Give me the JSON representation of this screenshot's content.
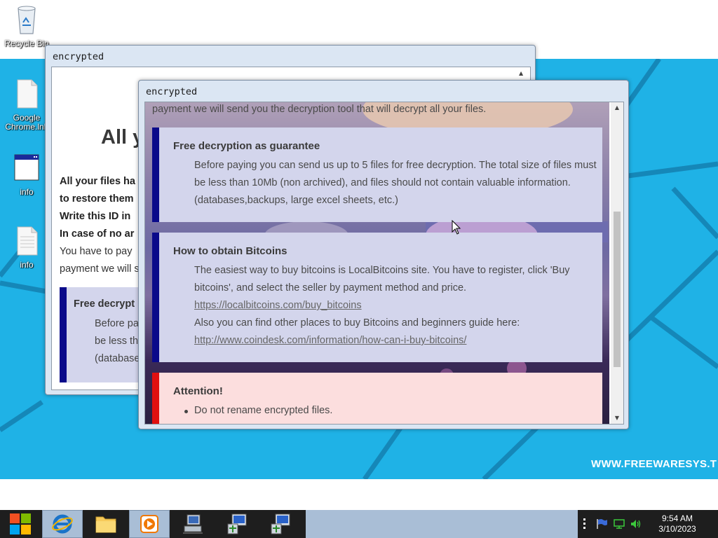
{
  "desktop": {
    "icons": [
      {
        "label": "Recycle Bin",
        "icon": "recycle-bin-icon"
      },
      {
        "label": "Google Chrome.lnk",
        "icon": "document-icon"
      },
      {
        "label": "info",
        "icon": "window-icon"
      },
      {
        "label": "info",
        "icon": "document-icon"
      }
    ],
    "watermark": "WWW.FREEWARESYS.T",
    "background_color": "#1fb2e6"
  },
  "back_window": {
    "title": "encrypted",
    "heading": "All y",
    "lines": [
      {
        "text": "All your files ha",
        "bold": true
      },
      {
        "text": "to restore them",
        "bold": true
      },
      {
        "text": "Write this ID in",
        "bold": true
      },
      {
        "text": "In case of no ar",
        "bold": true
      },
      {
        "text": "You have to pay",
        "bold": false
      },
      {
        "text": "payment we will s",
        "bold": false
      }
    ],
    "box": {
      "heading": "Free decrypt",
      "lines": [
        "Before pa",
        "be less th",
        "(database"
      ]
    }
  },
  "front_window": {
    "title": "encrypted",
    "top_line": "payment we will send you the decryption tool that will decrypt all your files.",
    "sections": [
      {
        "heading": "Free decryption as guarantee",
        "lines": [
          "Before paying you can send us up to 5 files for free decryption. The total size of files must",
          "be less than 10Mb (non archived), and files should not contain valuable information.",
          "(databases,backups, large excel sheets, etc.)"
        ]
      },
      {
        "heading": "How to obtain Bitcoins",
        "line1": "The easiest way to buy bitcoins is LocalBitcoins site. You have to register, click 'Buy",
        "line2": "bitcoins', and select the seller by payment method and price.",
        "link1": "https://localbitcoins.com/buy_bitcoins",
        "line3": "Also you can find other places to buy Bitcoins and beginners guide here:",
        "link2": "http://www.coindesk.com/information/how-can-i-buy-bitcoins/"
      },
      {
        "heading": "Attention!",
        "bullets": [
          "Do not rename encrypted files."
        ]
      }
    ],
    "colors": {
      "panel_bg": "#d3d5ec",
      "panel_stripe": "#0a0a8a",
      "attention_bg": "#fcdede",
      "attention_stripe": "#e01010"
    }
  },
  "taskbar": {
    "buttons": [
      {
        "name": "start-button",
        "icon": "windows-logo-icon"
      },
      {
        "name": "internet-explorer",
        "icon": "internet-explorer-icon"
      },
      {
        "name": "file-explorer",
        "icon": "folder-icon"
      },
      {
        "name": "media-player",
        "icon": "media-player-icon"
      },
      {
        "name": "network-app",
        "icon": "computer-icon"
      },
      {
        "name": "encrypted-window-1",
        "icon": "setup-app-icon"
      },
      {
        "name": "encrypted-window-2",
        "icon": "setup-app-icon"
      }
    ],
    "tray": {
      "time": "9:54 AM",
      "date": "3/10/2023",
      "icons": [
        "flag-icon",
        "network-icon",
        "volume-icon"
      ]
    }
  }
}
